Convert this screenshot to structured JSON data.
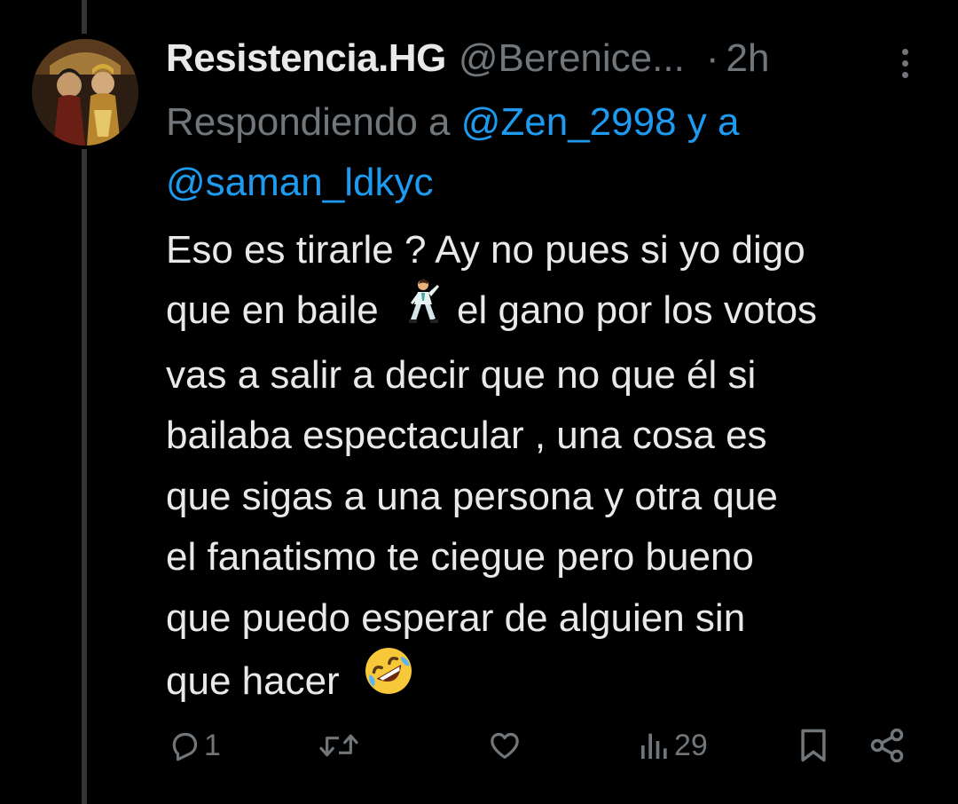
{
  "author": {
    "display_name": "Resistencia.HG",
    "handle": "@Berenice...",
    "separator": "·",
    "time": "2h"
  },
  "replying": {
    "prefix": "Respondiendo a",
    "mention_1": "@Zen_2998",
    "conjunction": "y a",
    "mention_2": "@saman_ldkyc"
  },
  "tweet": {
    "lines": [
      "Eso es tirarle ? Ay no pues si yo digo",
      "que en baile",
      "el gano por los votos",
      "vas a salir a decir que no que él si",
      "bailaba espectacular , una cosa es",
      "que sigas a una persona y otra que",
      "el fanatismo te ciegue pero bueno",
      "que puedo esperar de alguien sin",
      "que hacer"
    ],
    "emoji_1": "man-dancing-emoji",
    "emoji_2": "rolling-on-floor-laughing-emoji"
  },
  "actions": {
    "reply_count": "1",
    "retweet_count": "",
    "like_count": "",
    "views_count": "29"
  },
  "colors": {
    "background": "#000000",
    "text_primary": "#e7e9ea",
    "text_secondary": "#71767b",
    "link": "#1d9bf0",
    "thread_line": "#333639"
  }
}
